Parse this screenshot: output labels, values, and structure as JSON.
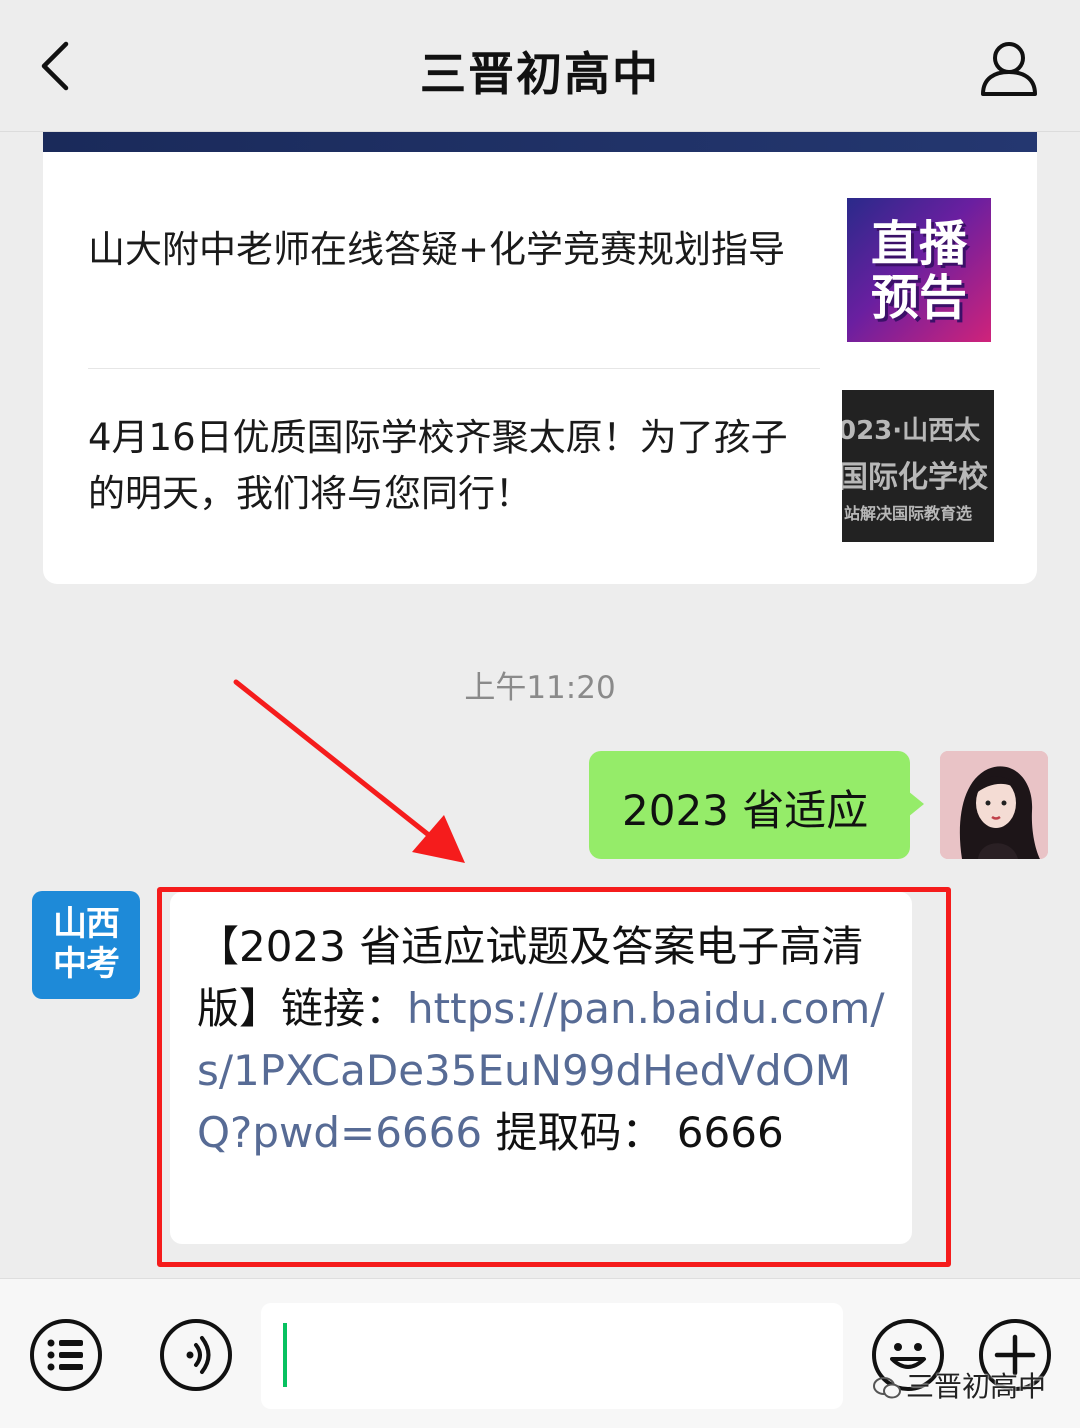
{
  "header": {
    "title": "三晋初高中"
  },
  "articles": [
    {
      "title": "山大附中老师在线答疑+化学竞赛规划指导",
      "thumbnail_lines": [
        "直播",
        "预告"
      ]
    },
    {
      "title": "4月16日优质国际学校齐聚太原！为了孩子的明天，我们将与您同行！",
      "thumbnail_lines": [
        "023·山西太",
        "国际化学校",
        "站解决国际教育选"
      ]
    }
  ],
  "chat": {
    "timestamp": "上午11:20",
    "sent_message": "2023 省适应",
    "received_avatar_lines": [
      "山西",
      "中考"
    ],
    "received_message": {
      "prefix": "【2023 省适应试题及答案电子高清版】链接：",
      "link": "https://pan.baidu.com/s/1PXCaDe35EuN99dHedVdOMQ?pwd=6666",
      "suffix": " 提取码：  6666"
    }
  },
  "watermark": "三晋初高中",
  "colors": {
    "sent_bubble": "#95ec69",
    "link": "#576b95",
    "highlight_box": "#f51c1c",
    "arrow": "#f51c1c",
    "org_avatar": "#1e8ad8",
    "caret": "#07c160"
  }
}
